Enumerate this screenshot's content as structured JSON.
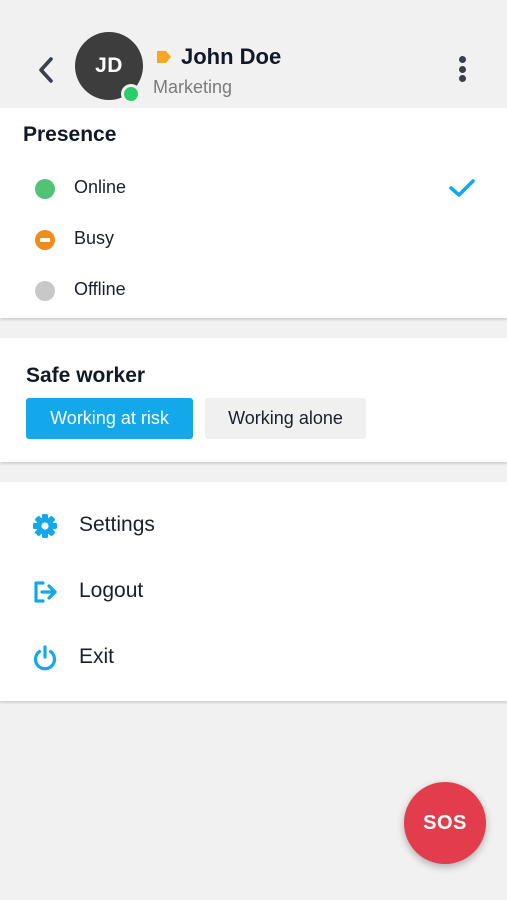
{
  "header": {
    "back_icon": "chevron-left-icon",
    "avatar_initials": "JD",
    "user_name": "John Doe",
    "department": "Marketing",
    "tag_icon": "tag-icon",
    "more_icon": "more-vertical-icon",
    "status_color": "#2ccc6a"
  },
  "presence": {
    "title": "Presence",
    "items": [
      {
        "label": "Online",
        "color": "#52c275",
        "selected": true
      },
      {
        "label": "Busy",
        "color": "#f08c1c",
        "selected": false
      },
      {
        "label": "Offline",
        "color": "#c8c8c8",
        "selected": false
      }
    ],
    "check_icon": "check-icon",
    "check_color": "#12a8e9"
  },
  "safe_worker": {
    "title": "Safe worker",
    "options": [
      {
        "label": "Working at risk",
        "active": true
      },
      {
        "label": "Working alone",
        "active": false
      }
    ]
  },
  "menu": {
    "items": [
      {
        "label": "Settings",
        "icon": "gear-icon"
      },
      {
        "label": "Logout",
        "icon": "logout-icon"
      },
      {
        "label": "Exit",
        "icon": "power-icon"
      }
    ],
    "icon_color": "#12a8e9"
  },
  "sos": {
    "label": "SOS",
    "color": "#e23c4d"
  },
  "colors": {
    "accent": "#12a8e9",
    "background": "#f1f1f1",
    "tag": "#f5a623"
  }
}
